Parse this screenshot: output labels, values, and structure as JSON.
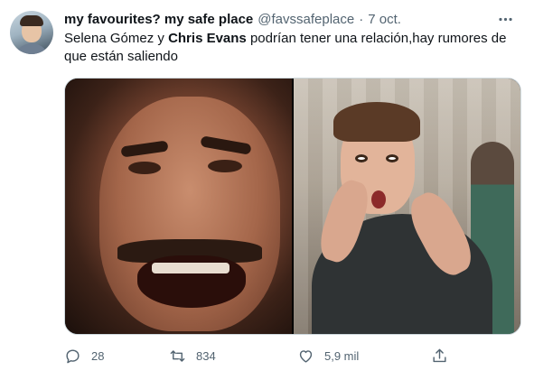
{
  "tweet": {
    "author_name": "my favourites? my safe place",
    "author_handle": "@favssafeplace",
    "separator": "·",
    "date": "7 oct.",
    "text_before": "Selena Gómez y ",
    "text_bold": "Chris Evans",
    "text_after": " podrían tener una relación,hay rumores de que están saliendo",
    "media": [
      {
        "description": "man-open-mouth-photo"
      },
      {
        "description": "boy-excited-photo"
      }
    ],
    "actions": {
      "reply_count": "28",
      "retweet_count": "834",
      "like_count": "5,9 mil"
    },
    "icons": {
      "reply": "reply-icon",
      "retweet": "retweet-icon",
      "like": "heart-icon",
      "share": "share-icon",
      "more": "more-icon"
    },
    "colors": {
      "text": "#0f1419",
      "secondary": "#536471",
      "border": "#cfd9de"
    }
  }
}
